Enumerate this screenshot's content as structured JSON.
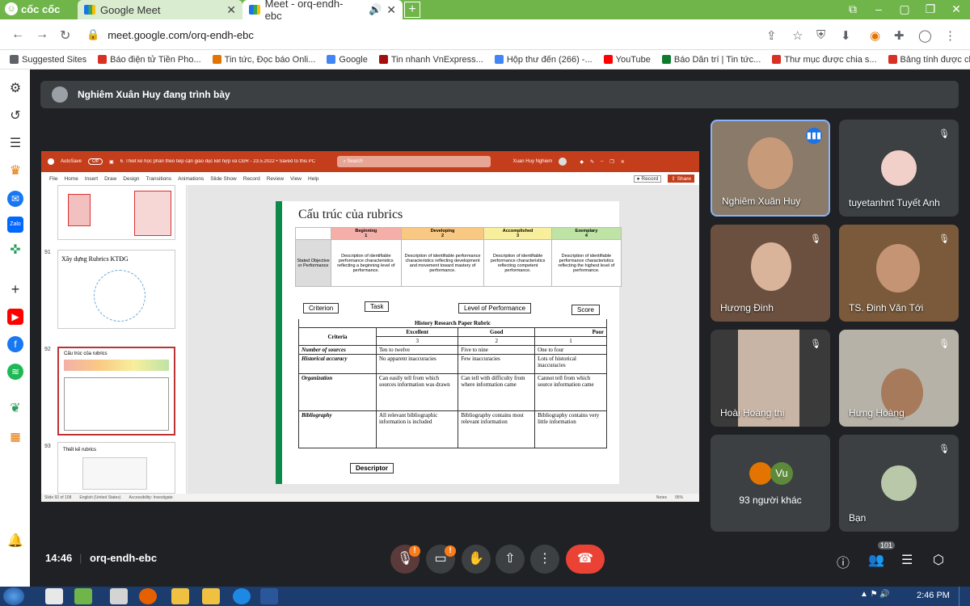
{
  "browser": {
    "brand": "cốc cốc",
    "tabs": [
      {
        "title": "Google Meet",
        "active": false
      },
      {
        "title": "Meet - orq-endh-ebc",
        "active": true
      }
    ],
    "url": "meet.google.com/orq-endh-ebc",
    "bookmarks": [
      {
        "label": "Suggested Sites",
        "color": "#5f6368"
      },
      {
        "label": "Báo điện tử Tiền Pho...",
        "color": "#d93025"
      },
      {
        "label": "Tin tức, Đọc báo Onli...",
        "color": "#e37400"
      },
      {
        "label": "Google",
        "color": "#4285f4"
      },
      {
        "label": "Tin nhanh VnExpress...",
        "color": "#a50e0e"
      },
      {
        "label": "Hộp thư đến (266) -...",
        "color": "#4285f4"
      },
      {
        "label": "YouTube",
        "color": "#ff0000"
      },
      {
        "label": "Báo Dân trí | Tin tức...",
        "color": "#0f7a2e"
      },
      {
        "label": "Thư mục được chia s...",
        "color": "#d93025"
      },
      {
        "label": "Bảng tính được chia...",
        "color": "#d93025"
      }
    ]
  },
  "meet": {
    "presenting_banner": "Nghiêm Xuân Huy đang trình bày",
    "time": "14:46",
    "meeting_code": "orq-endh-ebc",
    "participant_count": "101",
    "tiles": [
      {
        "name": "Nghiêm Xuân Huy",
        "speaking": true
      },
      {
        "name": "tuyetanhnt Tuyết Anh",
        "speaking": false
      },
      {
        "name": "Hương Đinh",
        "speaking": false
      },
      {
        "name": "TS. Đinh Văn Tới",
        "speaking": false
      },
      {
        "name": "Hoài Hoàng thị",
        "speaking": false
      },
      {
        "name": "Hưng Hoàng",
        "speaking": false
      },
      {
        "name": "93 người khác",
        "speaking": false
      },
      {
        "name": "Bạn",
        "speaking": false
      }
    ],
    "others_initial": "Vu"
  },
  "ppt": {
    "title_bar": "6. Thiết kế học phần theo tiếp cận giáo dục kết hợp và CĐR - 23.5.2022 • Saved to this PC",
    "search": "Search",
    "user": "Xuan Huy Nghiem",
    "autosave": "AutoSave",
    "autosave_state": "Off",
    "menu": [
      "File",
      "Home",
      "Insert",
      "Draw",
      "Design",
      "Transitions",
      "Animations",
      "Slide Show",
      "Record",
      "Review",
      "View",
      "Help"
    ],
    "record_btn": "Record",
    "share_btn": "Share",
    "thumbs": [
      {
        "num": "91",
        "title": "Xây dựng Rubrics KTĐG"
      },
      {
        "num": "92",
        "title": "Cấu trúc của rubrics"
      },
      {
        "num": "93",
        "title": "Thiết kế rubrics"
      }
    ],
    "status": [
      "Slide 92 of 108",
      "English (United States)",
      "Accessibility: Investigate",
      "Notes",
      "95%"
    ]
  },
  "slide": {
    "title": "Cấu trúc của rubrics",
    "levels": [
      {
        "name": "Beginning",
        "score": "1",
        "color": "#f4b0a8",
        "desc": "Description of identifiable performance characteristics reflecting a beginning level of performance."
      },
      {
        "name": "Developing",
        "score": "2",
        "color": "#f9c984",
        "desc": "Description of identifiable performance characteristics reflecting development and movement toward mastery of performance."
      },
      {
        "name": "Accomplished",
        "score": "3",
        "color": "#f7ef9c",
        "desc": "Description of identifiable performance characteristics reflecting competent performance."
      },
      {
        "name": "Exemplary",
        "score": "4",
        "color": "#bfe3a5",
        "desc": "Description of identifiable performance characteristics reflecting the highest level of performance."
      }
    ],
    "row_label": "Stated Objective or Performance",
    "labels": {
      "criterion": "Criterion",
      "task": "Task",
      "level": "Level of Performance",
      "score": "Score",
      "descriptor": "Descriptor"
    },
    "hrp": {
      "title": "History Research Paper Rubric",
      "criteria_head": "Criteria",
      "cols": [
        {
          "name": "Excellent",
          "score": "3"
        },
        {
          "name": "Good",
          "score": "2"
        },
        {
          "name": "Poor",
          "score": "1"
        }
      ],
      "rows": [
        {
          "criterion": "Number of sources",
          "cells": [
            "Ten to twelve",
            "Five to nine",
            "One to four"
          ]
        },
        {
          "criterion": "Historical accuracy",
          "cells": [
            "No apparent inaccuracies",
            "Few inaccuracies",
            "Lots of historical inaccuracies"
          ]
        },
        {
          "criterion": "Organization",
          "cells": [
            "Can easily tell from which sources information was drawn",
            "Can tell with difficulty from where information came",
            "Cannot tell from which source information came"
          ]
        },
        {
          "criterion": "Bibliography",
          "cells": [
            "All relevant bibliographic information is included",
            "Bibliography contains most relevant information",
            "Bibliography contains very little information"
          ]
        }
      ]
    }
  },
  "taskbar": {
    "clock": "2:46 PM"
  }
}
